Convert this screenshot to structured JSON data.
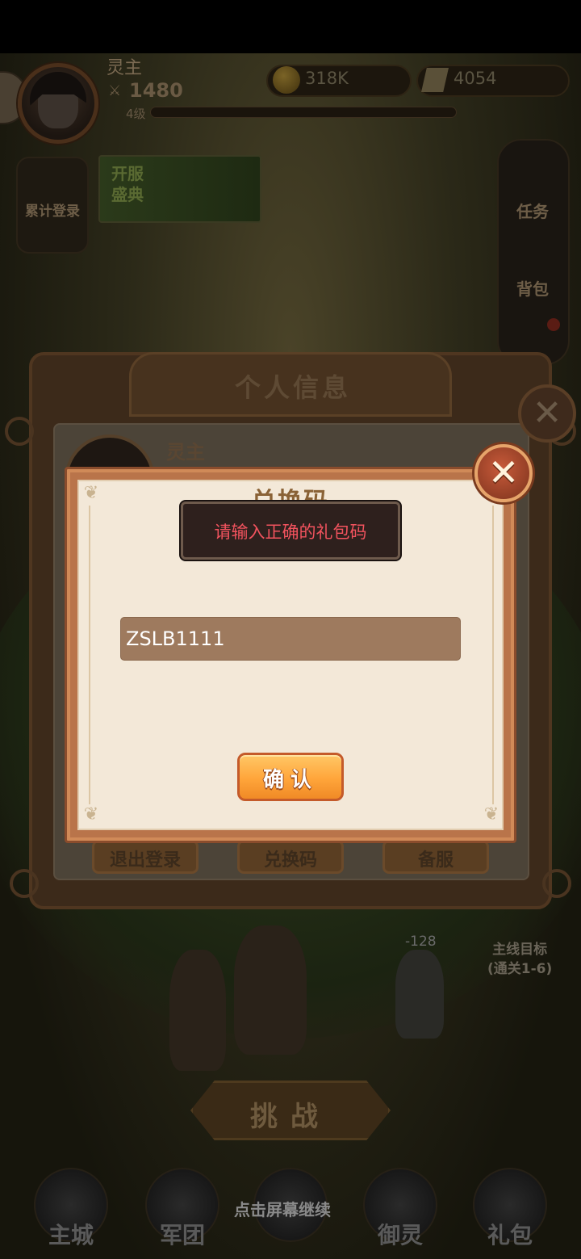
{
  "hud": {
    "player_name": "灵主",
    "power_value": "1480",
    "level_label": "4级",
    "gold_value": "318K",
    "gem_value": "4054"
  },
  "side_buttons": {
    "cumulative_login": "累计登录",
    "event_banner": "开服\n盛典",
    "tasks": "任务",
    "backpack": "背包"
  },
  "scene": {
    "damage_number": "-128",
    "mainline_goal_line1": "主线目标",
    "mainline_goal_line2": "(通关1-6)",
    "challenge_label": "挑战",
    "tap_hint": "点击屏幕继续"
  },
  "bottom_nav": {
    "items": [
      {
        "label": "主城",
        "icon": "castle-icon"
      },
      {
        "label": "军团",
        "icon": "legion-icon"
      },
      {
        "label": "",
        "icon": "campaign-icon"
      },
      {
        "label": "御灵",
        "icon": "spirit-icon"
      },
      {
        "label": "礼包",
        "icon": "gift-shop-icon"
      }
    ]
  },
  "info_panel": {
    "title": "个人信息",
    "player_name": "灵主",
    "buttons": {
      "logout": "退出登录",
      "redeem": "兑换码",
      "backup_server": "备服"
    }
  },
  "redeem_dialog": {
    "title": "兑换码",
    "toast_message": "请输入正确的礼包码",
    "code_value": "ZSLB1111",
    "confirm_label": "确认"
  },
  "colors": {
    "toast_text": "#f2535e",
    "confirm_orange": "#ffa53a",
    "dialog_frame": "#b9744a",
    "paper": "#f3e8d8",
    "input_bg": "#9e7a5e"
  }
}
